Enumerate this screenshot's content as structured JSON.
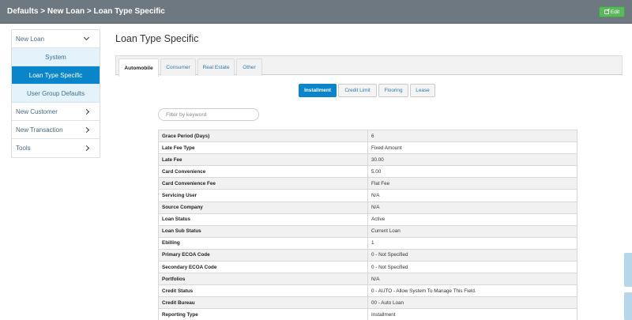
{
  "header": {
    "breadcrumb": "Defaults > New Loan > Loan Type Specific",
    "edit_label": "Edit"
  },
  "sidebar": {
    "items": [
      {
        "label": "New Loan",
        "chevron": "chevron-down-icon"
      },
      {
        "label": "System"
      },
      {
        "label": "Loan Type Specific",
        "active": true
      },
      {
        "label": "User Group Defaults"
      },
      {
        "label": "New Customer",
        "chevron": "chevron-right-icon"
      },
      {
        "label": "New Transaction",
        "chevron": "chevron-right-icon"
      },
      {
        "label": "Tools",
        "chevron": "chevron-right-icon"
      }
    ]
  },
  "main": {
    "title": "Loan Type Specific",
    "tabs": [
      {
        "label": "Automobile",
        "active": true
      },
      {
        "label": "Consumer"
      },
      {
        "label": "Real Estate"
      },
      {
        "label": "Other"
      }
    ],
    "pills": [
      {
        "label": "Installment",
        "active": true
      },
      {
        "label": "Credit Limit"
      },
      {
        "label": "Flooring"
      },
      {
        "label": "Lease"
      }
    ],
    "filter": {
      "placeholder": "Filter by keyword",
      "value": ""
    },
    "rows": [
      {
        "label": "Grace Period (Days)",
        "value": "6"
      },
      {
        "label": "Late Fee Type",
        "value": "Fixed Amount"
      },
      {
        "label": "Late Fee",
        "value": "30.00"
      },
      {
        "label": "Card Convenience",
        "value": "5.00"
      },
      {
        "label": "Card Convenience Fee",
        "value": "Flat Fee"
      },
      {
        "label": "Servicing User",
        "value": "N/A"
      },
      {
        "label": "Source Company",
        "value": "N/A"
      },
      {
        "label": "Loan Status",
        "value": "Active"
      },
      {
        "label": "Loan Sub Status",
        "value": "Current Loan"
      },
      {
        "label": "Ebilling",
        "value": "1"
      },
      {
        "label": "Primary ECOA Code",
        "value": "0 - Not Specified"
      },
      {
        "label": "Secondary ECOA Code",
        "value": "0 - Not Specified"
      },
      {
        "label": "Portfolios",
        "value": "N/A"
      },
      {
        "label": "Credit Status",
        "value": "0 - AUTO - Allow System To Manage This Field."
      },
      {
        "label": "Credit Bureau",
        "value": "00 - Auto Loan"
      },
      {
        "label": "Reporting Type",
        "value": "Installment"
      }
    ]
  },
  "colors": {
    "topbar": "#6e7880",
    "accent": "#0a85c9",
    "edit_button": "#5cb85c",
    "sub_item_bg": "#e4f3fb"
  }
}
